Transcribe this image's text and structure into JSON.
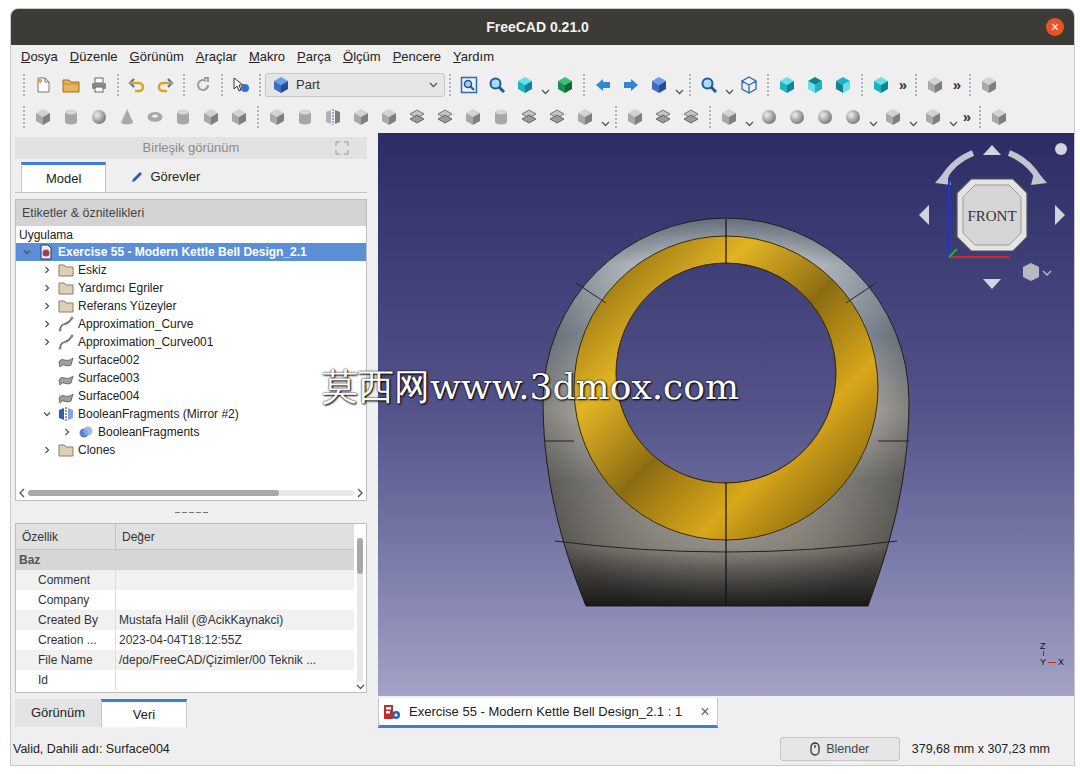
{
  "window": {
    "title": "FreeCAD 0.21.0",
    "close": "×"
  },
  "menu": [
    "Dosya",
    "Düzenle",
    "Görünüm",
    "Araçlar",
    "Makro",
    "Parça",
    "Ölçüm",
    "Pencere",
    "Yardım"
  ],
  "toolbar": {
    "workbench": "Part",
    "row1_more": [
      "»",
      "»"
    ],
    "row2_more": [
      "»"
    ]
  },
  "combo_view": {
    "title": "Birleşik görünüm",
    "tabs": [
      {
        "label": "Model",
        "selected": true
      },
      {
        "label": "Görevler",
        "selected": false
      }
    ]
  },
  "tree": {
    "header": "Etiketler & öznitelikleri",
    "group": "Uygulama",
    "hscroll_level": 0.77,
    "items": [
      {
        "label": "Exercise 55 - Modern Kettle Bell Design_2.1",
        "depth": 0,
        "kind": "document",
        "expandable": true,
        "expanded": true,
        "selected": true
      },
      {
        "label": "Eskiz",
        "depth": 1,
        "kind": "folder",
        "expandable": true,
        "expanded": false,
        "selected": false
      },
      {
        "label": "Yardımcı Egriler",
        "depth": 1,
        "kind": "folder",
        "expandable": true,
        "expanded": false,
        "selected": false
      },
      {
        "label": "Referans Yüzeyler",
        "depth": 1,
        "kind": "folder",
        "expandable": true,
        "expanded": false,
        "selected": false
      },
      {
        "label": "Approximation_Curve",
        "depth": 1,
        "kind": "curve",
        "expandable": true,
        "expanded": false,
        "selected": false
      },
      {
        "label": "Approximation_Curve001",
        "depth": 1,
        "kind": "curve",
        "expandable": true,
        "expanded": false,
        "selected": false
      },
      {
        "label": "Surface002",
        "depth": 1,
        "kind": "surface",
        "expandable": false,
        "expanded": false,
        "selected": false
      },
      {
        "label": "Surface003",
        "depth": 1,
        "kind": "surface",
        "expandable": false,
        "expanded": false,
        "selected": false
      },
      {
        "label": "Surface004",
        "depth": 1,
        "kind": "surface",
        "expandable": false,
        "expanded": false,
        "selected": false
      },
      {
        "label": "BooleanFragments (Mirror #2)",
        "depth": 1,
        "kind": "mirror",
        "expandable": true,
        "expanded": true,
        "selected": false
      },
      {
        "label": "BooleanFragments",
        "depth": 2,
        "kind": "boolean",
        "expandable": true,
        "expanded": false,
        "selected": false
      },
      {
        "label": "Clones",
        "depth": 1,
        "kind": "folder",
        "expandable": true,
        "expanded": false,
        "selected": false
      }
    ]
  },
  "properties": {
    "columns": [
      "Özellik",
      "Değer"
    ],
    "group": "Baz",
    "vscroll_level": 0.25,
    "rows": [
      {
        "name": "Comment",
        "value": ""
      },
      {
        "name": "Company",
        "value": ""
      },
      {
        "name": "Created By",
        "value": "Mustafa Halil (@AcikKaynakci)"
      },
      {
        "name": "Creation ...",
        "value": "2023-04-04T18:12:55Z"
      },
      {
        "name": "File Name",
        "value": "/depo/FreeCAD/Çizimler/00 Teknik ..."
      },
      {
        "name": "Id",
        "value": ""
      }
    ]
  },
  "bottom_tabs": [
    {
      "label": "Görünüm",
      "selected": false
    },
    {
      "label": "Veri",
      "selected": true
    }
  ],
  "view": {
    "watermark": "莫西网www.3dmox.com",
    "navcube": "FRONT",
    "axes": [
      "Z",
      "Y",
      "X"
    ]
  },
  "document_tab": {
    "label": "Exercise 55 - Modern Kettle Bell Design_2.1 : 1",
    "close": "×",
    "selected": true
  },
  "status_bar": {
    "message": "Valid, Dahili adı: Surface004",
    "nav_style": "Blender",
    "dimensions": "379,68 mm x 307,23 mm"
  }
}
